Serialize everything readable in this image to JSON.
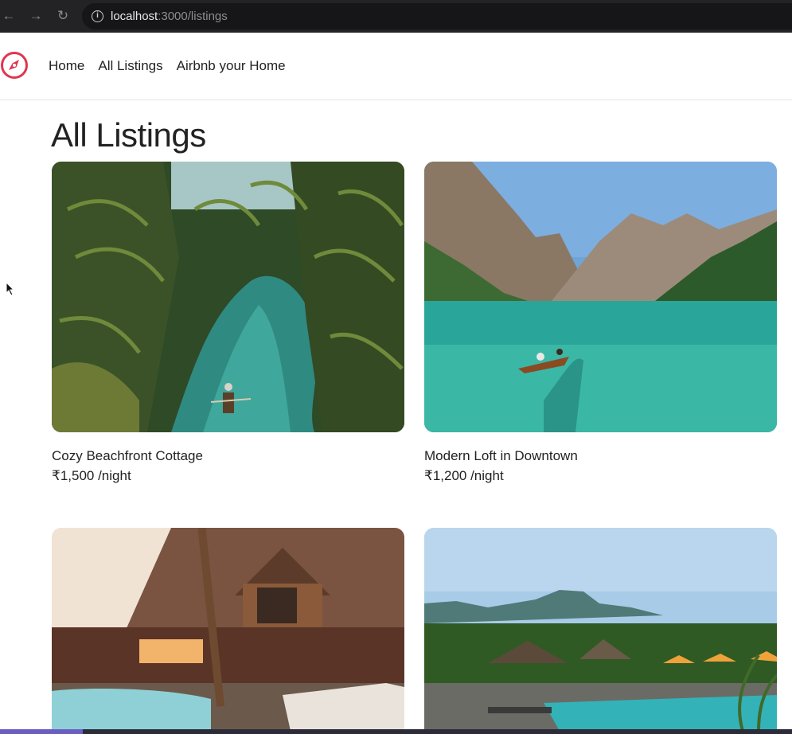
{
  "browser": {
    "url_host": "localhost",
    "url_path": ":3000/listings"
  },
  "nav": {
    "items": [
      "Home",
      "All Listings",
      "Airbnb your Home"
    ]
  },
  "page": {
    "title": "All Listings"
  },
  "listings": [
    {
      "title": "Cozy Beachfront Cottage",
      "price": "₹1,500 /night",
      "image": "tropical-lagoon-with-palms-and-boat"
    },
    {
      "title": "Modern Loft in Downtown",
      "price": "₹1,200 /night",
      "image": "mountain-lake-with-rowboat"
    },
    {
      "title": "",
      "price": "",
      "image": "wooden-lodge-with-pool"
    },
    {
      "title": "",
      "price": "",
      "image": "tropical-resort-with-pool-and-mountains"
    }
  ],
  "colors": {
    "brand": "#e0364f",
    "text": "#222222",
    "chrome": "#232326"
  }
}
